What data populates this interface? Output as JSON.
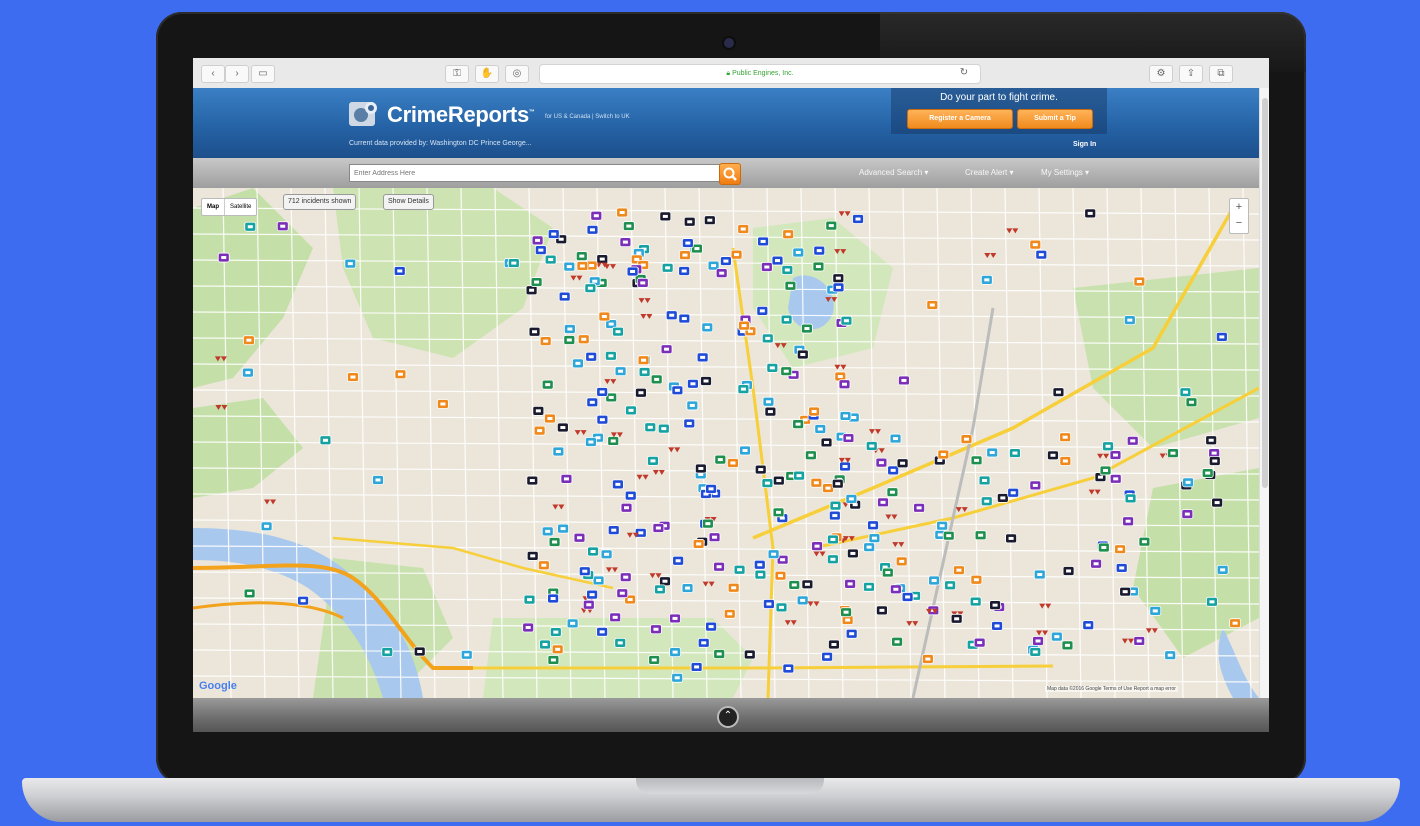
{
  "browser": {
    "url": "Public Engines, Inc.",
    "back": "‹",
    "forward": "›"
  },
  "header": {
    "logo": "CrimeReports",
    "logo_tm": "™",
    "logo_sub": "for US & Canada | Switch to UK",
    "data_provided": "Current data provided by: Washington DC   Prince George...",
    "promo_text": "Do your part to fight crime.",
    "register_label": "Register a Camera",
    "tip_label": "Submit a Tip",
    "signin": "Sign In"
  },
  "search": {
    "placeholder": "Enter Address Here",
    "advanced": "Advanced Search",
    "alert": "Create Alert",
    "settings": "My Settings"
  },
  "map": {
    "map_label": "Map",
    "satellite_label": "Satellite",
    "incidents_shown": "712 incidents shown",
    "show_details": "Show Details",
    "zoom_in": "+",
    "zoom_out": "−",
    "google": "Google",
    "credits": "Map data ©2016 Google   Terms of Use   Report a map error",
    "marker_colors": [
      "#1f4bd6",
      "#2fa6d8",
      "#c0392b",
      "#f0891c",
      "#1e8f4e",
      "#7b2fb8",
      "#1a1a2e",
      "#17a2a2"
    ]
  },
  "colors": {
    "page_bg": "#3d6cf0",
    "header_blue": "#2563a6",
    "accent_orange": "#f08a1c"
  }
}
